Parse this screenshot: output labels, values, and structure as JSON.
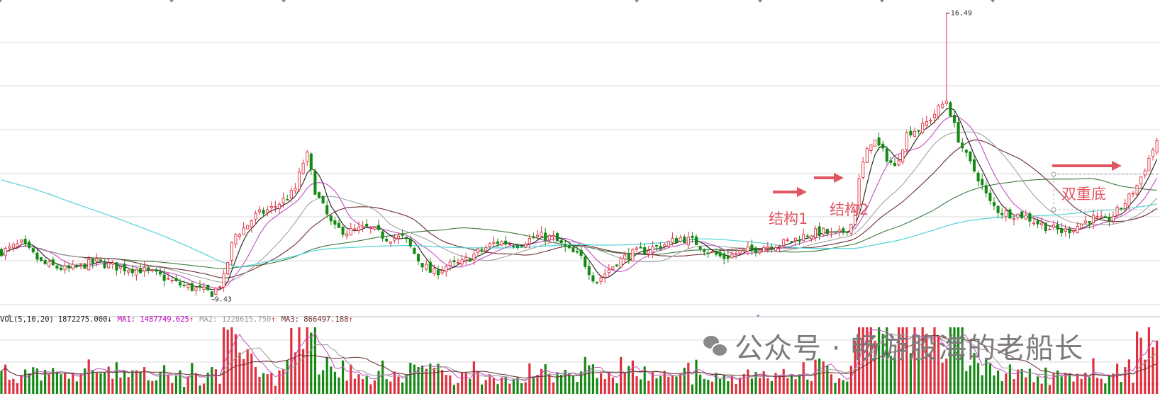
{
  "chart_data": {
    "type": "candlestick",
    "price_ylim": [
      9.0,
      16.8
    ],
    "extreme_labels": {
      "low": "9.43",
      "high": "16.49"
    },
    "candles": [],
    "volume_panel": {
      "legend": {
        "label": "VOL(5,10,20)",
        "vol": "1872275.000",
        "vol_arrow": "↓",
        "ma1": "MA1: 1487749.625",
        "ma1_arrow": "↑",
        "ma2": "MA2: 1228615.750",
        "ma2_arrow": "↑",
        "ma3": "MA3: 866497.188",
        "ma3_arrow": "↑"
      }
    },
    "annotations": [
      {
        "text": "结构1"
      },
      {
        "text": "结构2"
      },
      {
        "text": "双重底"
      }
    ]
  },
  "colors": {
    "up": "#e0303f",
    "down": "#148a14",
    "ma_black": "#1a1a1a",
    "ma_magenta": "#c050c0",
    "ma_gray": "#9a9a9a",
    "ma_brown": "#6b2d2d",
    "ma_green": "#3e7a3e",
    "ma_cyan": "#4fd3d8",
    "annotation": "#e05560",
    "grid": "#d9d9d9"
  },
  "watermark": {
    "icon": "wechat-icon",
    "text": "公众号 · 畅游股海的老船长"
  }
}
